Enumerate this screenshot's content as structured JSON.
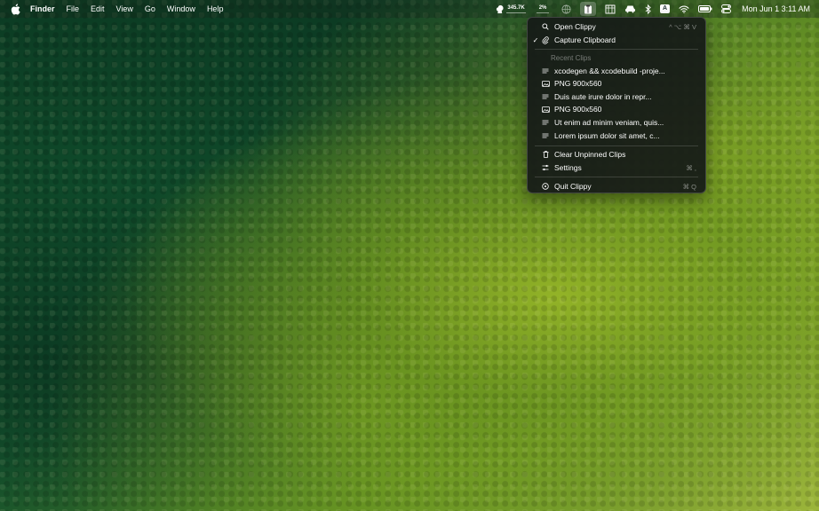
{
  "menubar": {
    "app_name": "Finder",
    "menus": [
      "File",
      "Edit",
      "View",
      "Go",
      "Window",
      "Help"
    ],
    "network_stat": "345.7K",
    "cpu_stat": "2%",
    "input_source": "A",
    "clock": "Mon Jun 1   3:11 AM"
  },
  "clippy_menu": {
    "open": {
      "label": "Open Clippy",
      "shortcut": "^ ⌥ ⌘ V"
    },
    "capture": {
      "label": "Capture Clipboard",
      "checked": "✓"
    },
    "recent_header": "Recent Clips",
    "recent_clips": [
      {
        "label": "xcodegen && xcodebuild -proje...",
        "kind": "text"
      },
      {
        "label": "PNG 900x560",
        "kind": "image"
      },
      {
        "label": "Duis aute irure dolor in repr...",
        "kind": "text"
      },
      {
        "label": "PNG 900x560",
        "kind": "image"
      },
      {
        "label": "Ut enim ad minim veniam, quis...",
        "kind": "text"
      },
      {
        "label": "Lorem ipsum dolor sit amet, c...",
        "kind": "text"
      }
    ],
    "clear": {
      "label": "Clear Unpinned Clips"
    },
    "settings": {
      "label": "Settings",
      "shortcut": "⌘ ,"
    },
    "quit": {
      "label": "Quit Clippy",
      "shortcut": "⌘ Q"
    }
  },
  "colors": {
    "menu_bg": "#161a18",
    "menu_text": "#ffffff",
    "forest_dark": "#0d3a24",
    "forest_light": "#9cb53a"
  }
}
